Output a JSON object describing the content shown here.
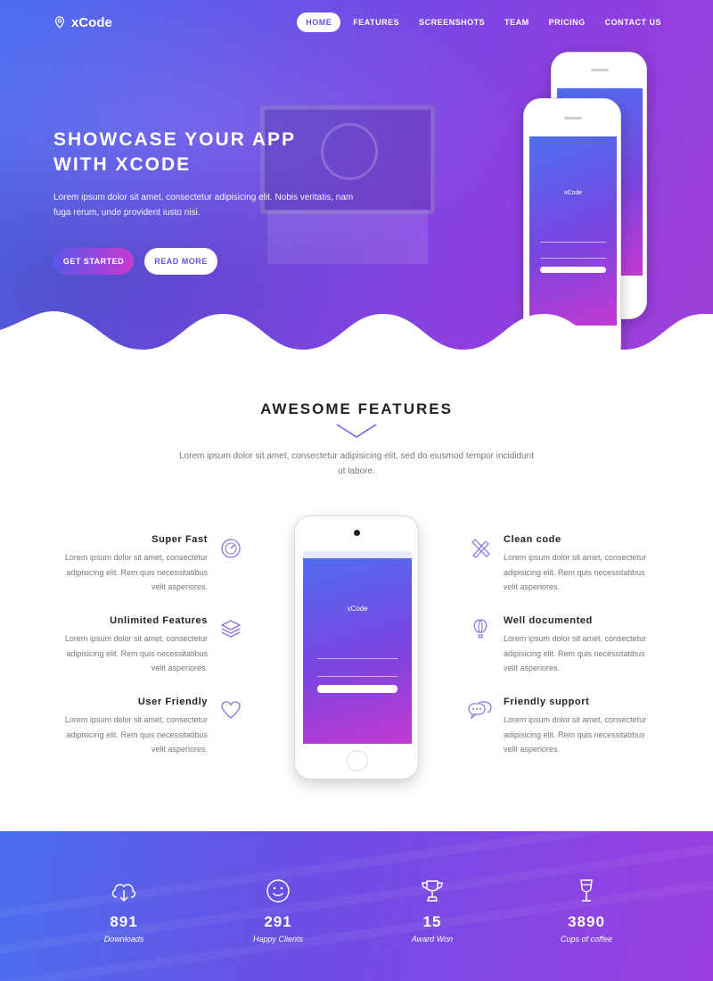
{
  "nav": {
    "logo": "xCode",
    "items": [
      {
        "label": "HOME",
        "active": true
      },
      {
        "label": "FEATURES",
        "active": false
      },
      {
        "label": "SCREENSHOTS",
        "active": false
      },
      {
        "label": "TEAM",
        "active": false
      },
      {
        "label": "PRICING",
        "active": false
      },
      {
        "label": "CONTACT US",
        "active": false
      }
    ]
  },
  "hero": {
    "title_line1": "SHOWCASE YOUR APP",
    "title_line2": "WITH XCODE",
    "text": "Lorem ipsum dolor sit amet, consectetur adipisicing elit. Nobis veritatis, nam fuga rerum, unde provident iusto nisi.",
    "btn_primary": "GET STARTED",
    "btn_secondary": "READ MORE",
    "phone_app_name": "xCode"
  },
  "features": {
    "title": "AWESOME FEATURES",
    "subtitle": "Lorem ipsum dolor sit amet, consectetur adipisicing elit, sed do eiusmod tempor incididunt ut labore.",
    "phone_app_name": "xCode",
    "left": [
      {
        "title": "Super Fast",
        "text": "Lorem ipsum dolor sit amet, consectetur adipisicing elit. Rem quis necessitatibus velit asperiores.",
        "icon": "speedometer-icon"
      },
      {
        "title": "Unlimited Features",
        "text": "Lorem ipsum dolor sit amet, consectetur adipisicing elit. Rem quis necessitatibus velit asperiores.",
        "icon": "layers-icon"
      },
      {
        "title": "User Friendly",
        "text": "Lorem ipsum dolor sit amet, consectetur adipisicing elit. Rem quis necessitatibus velit asperiores.",
        "icon": "heart-icon"
      }
    ],
    "right": [
      {
        "title": "Clean code",
        "text": "Lorem ipsum dolor sit amet, consectetur adipisicing elit. Rem quis necessitatibus velit asperiores.",
        "icon": "pencil-ruler-icon"
      },
      {
        "title": "Well documented",
        "text": "Lorem ipsum dolor sit amet, consectetur adipisicing elit. Rem quis necessitatibus velit asperiores.",
        "icon": "hot-air-balloon-icon"
      },
      {
        "title": "Friendly support",
        "text": "Lorem ipsum dolor sit amet, consectetur adipisicing elit. Rem quis necessitatibus velit asperiores.",
        "icon": "chat-bubbles-icon"
      }
    ]
  },
  "stats": [
    {
      "number": "891",
      "label": "Downloads",
      "icon": "cloud-download-icon"
    },
    {
      "number": "291",
      "label": "Happy Clients",
      "icon": "smiley-icon"
    },
    {
      "number": "15",
      "label": "Award Won",
      "icon": "trophy-icon"
    },
    {
      "number": "3890",
      "label": "Cups of coffee",
      "icon": "wine-glass-icon"
    }
  ],
  "colors": {
    "accent": "#6a4fe6",
    "gradient_start": "#4a6ff0",
    "gradient_end": "#a040d8",
    "icon_purple": "#8a6fe0"
  }
}
